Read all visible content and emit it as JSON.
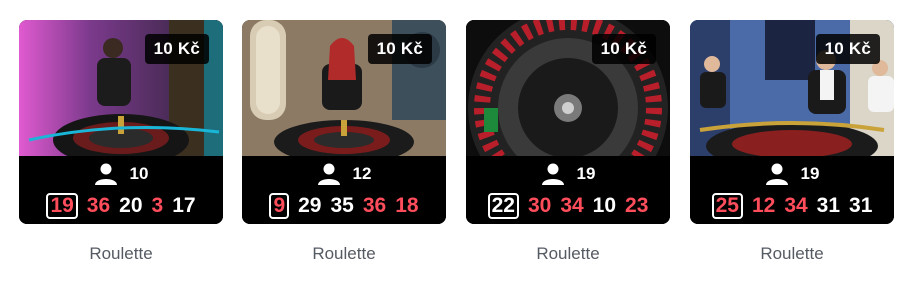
{
  "tiles": [
    {
      "bet": "10 Kč",
      "players": "10",
      "title": "Roulette",
      "results": [
        {
          "n": "19",
          "color": "red"
        },
        {
          "n": "36",
          "color": "red"
        },
        {
          "n": "20",
          "color": "black"
        },
        {
          "n": "3",
          "color": "red"
        },
        {
          "n": "17",
          "color": "black"
        }
      ]
    },
    {
      "bet": "10 Kč",
      "players": "12",
      "title": "Roulette",
      "results": [
        {
          "n": "9",
          "color": "red"
        },
        {
          "n": "29",
          "color": "black"
        },
        {
          "n": "35",
          "color": "black"
        },
        {
          "n": "36",
          "color": "red"
        },
        {
          "n": "18",
          "color": "red"
        }
      ]
    },
    {
      "bet": "10 Kč",
      "players": "19",
      "title": "Roulette",
      "results": [
        {
          "n": "22",
          "color": "black"
        },
        {
          "n": "30",
          "color": "red"
        },
        {
          "n": "34",
          "color": "red"
        },
        {
          "n": "10",
          "color": "black"
        },
        {
          "n": "23",
          "color": "red"
        }
      ]
    },
    {
      "bet": "10 Kč",
      "players": "19",
      "title": "Roulette",
      "results": [
        {
          "n": "25",
          "color": "red"
        },
        {
          "n": "12",
          "color": "red"
        },
        {
          "n": "34",
          "color": "red"
        },
        {
          "n": "31",
          "color": "black"
        },
        {
          "n": "31",
          "color": "black"
        }
      ]
    }
  ],
  "colors": {
    "red": "#ff4d5c",
    "black": "#ffffff",
    "bar_bg": "#000000",
    "title": "#555a63"
  },
  "icons": {
    "players": "user-icon"
  }
}
